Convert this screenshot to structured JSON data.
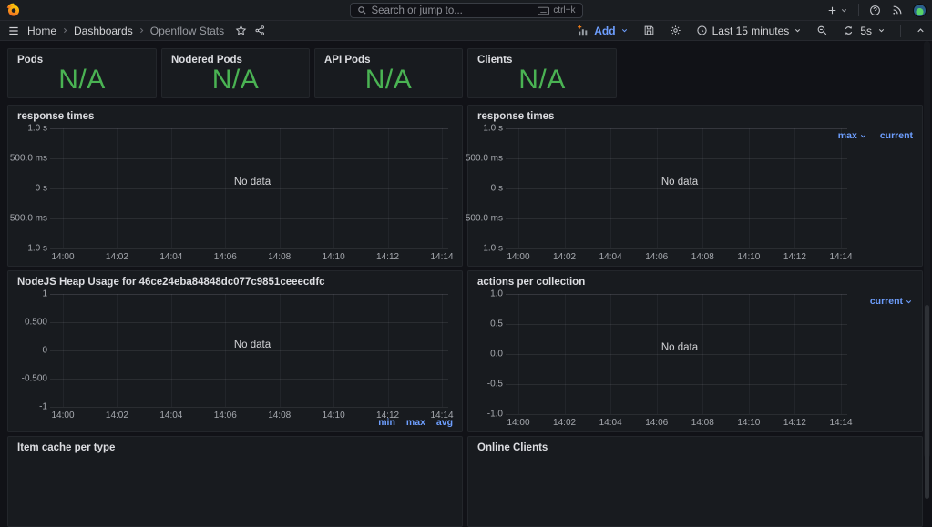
{
  "colors": {
    "accent_blue": "#6e9fff",
    "stat_green": "#4ab353",
    "add_plus_orange": "#eb7b18"
  },
  "topbar": {
    "search": {
      "placeholder": "Search or jump to...",
      "shortcut": "ctrl+k"
    }
  },
  "breadcrumb": {
    "items": [
      "Home",
      "Dashboards",
      "Openflow Stats"
    ]
  },
  "toolbar": {
    "add_label": "Add",
    "time_range": "Last 15 minutes",
    "refresh_interval": "5s"
  },
  "stats": [
    {
      "title": "Pods",
      "value": "N/A"
    },
    {
      "title": "Nodered Pods",
      "value": "N/A"
    },
    {
      "title": "API Pods",
      "value": "N/A"
    },
    {
      "title": "Clients",
      "value": "N/A"
    }
  ],
  "charts": [
    {
      "id": "response-times-left",
      "title": "response times",
      "no_data": "No data",
      "y_ticks": [
        "1.0 s",
        "500.0 ms",
        "0 s",
        "-500.0 ms",
        "-1.0 s"
      ],
      "x_ticks": [
        "14:00",
        "14:02",
        "14:04",
        "14:06",
        "14:08",
        "14:10",
        "14:12",
        "14:14"
      ],
      "legend_right": [],
      "legend_bottom": [],
      "series": []
    },
    {
      "id": "response-times-right",
      "title": "response times",
      "no_data": "No data",
      "y_ticks": [
        "1.0 s",
        "500.0 ms",
        "0 s",
        "-500.0 ms",
        "-1.0 s"
      ],
      "x_ticks": [
        "14:00",
        "14:02",
        "14:04",
        "14:06",
        "14:08",
        "14:10",
        "14:12",
        "14:14"
      ],
      "legend_right": [
        {
          "label": "max",
          "caret": true
        },
        {
          "label": "current",
          "caret": false
        }
      ],
      "legend_bottom": [],
      "series": []
    },
    {
      "id": "nodejs-heap-usage",
      "title": "NodeJS Heap Usage for 46ce24eba84848dc077c9851ceeecdfc",
      "no_data": "No data",
      "y_ticks": [
        "1",
        "0.500",
        "0",
        "-0.500",
        "-1"
      ],
      "x_ticks": [
        "14:00",
        "14:02",
        "14:04",
        "14:06",
        "14:08",
        "14:10",
        "14:12",
        "14:14"
      ],
      "legend_right": [],
      "legend_bottom": [
        {
          "label": "min",
          "caret": false
        },
        {
          "label": "max",
          "caret": false
        },
        {
          "label": "avg",
          "caret": false
        }
      ],
      "series": []
    },
    {
      "id": "actions-per-collection",
      "title": "actions per collection",
      "no_data": "No data",
      "y_ticks": [
        "1.0",
        "0.5",
        "0.0",
        "-0.5",
        "-1.0"
      ],
      "x_ticks": [
        "14:00",
        "14:02",
        "14:04",
        "14:06",
        "14:08",
        "14:10",
        "14:12",
        "14:14"
      ],
      "legend_right": [
        {
          "label": "current",
          "caret": true
        }
      ],
      "legend_bottom": [],
      "series": []
    }
  ],
  "bottom_panels": [
    {
      "title": "Item cache per type"
    },
    {
      "title": "Online Clients"
    }
  ]
}
